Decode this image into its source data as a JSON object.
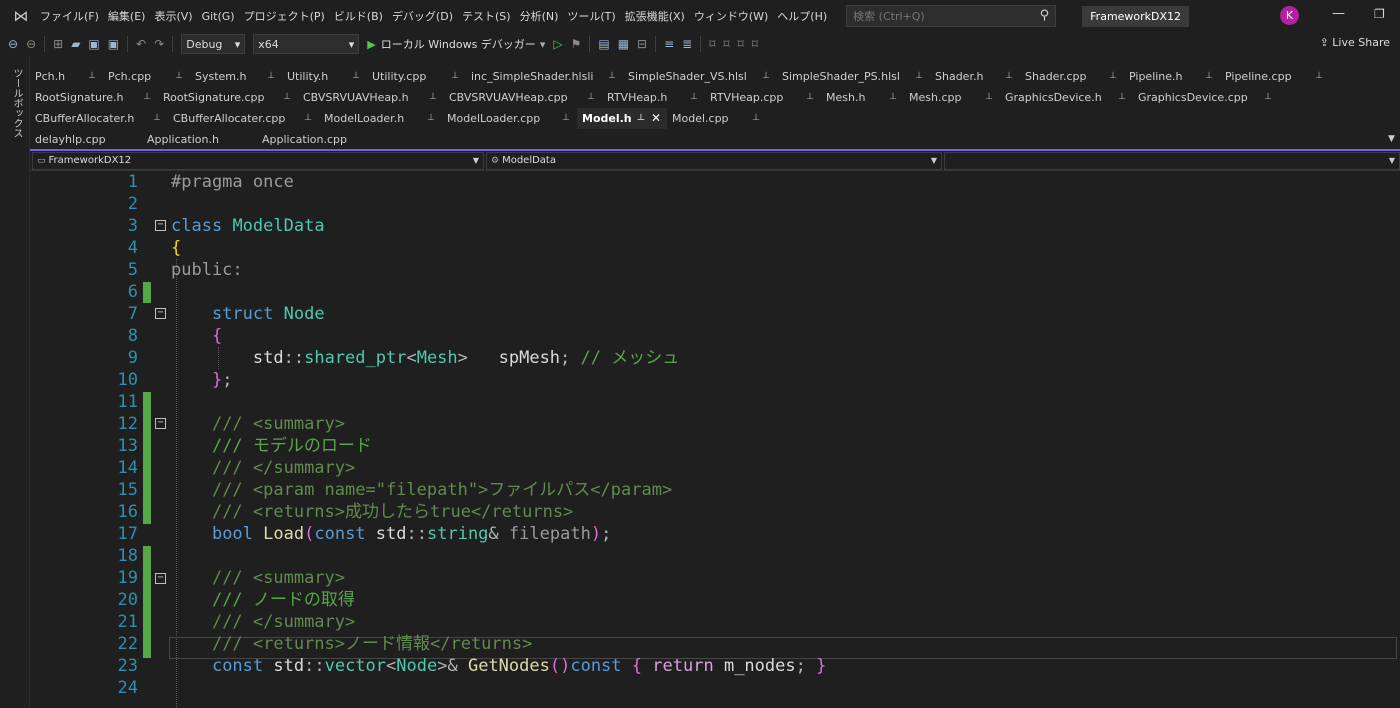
{
  "menu": {
    "items": [
      "ファイル(F)",
      "編集(E)",
      "表示(V)",
      "Git(G)",
      "プロジェクト(P)",
      "ビルド(B)",
      "デバッグ(D)",
      "テスト(S)",
      "分析(N)",
      "ツール(T)",
      "拡張機能(X)",
      "ウィンドウ(W)",
      "ヘルプ(H)"
    ],
    "search_placeholder": "検索 (Ctrl+Q)",
    "solution_name": "FrameworkDX12",
    "avatar_letter": "K"
  },
  "toolbar": {
    "configuration": "Debug",
    "platform": "x64",
    "run_label": "ローカル Windows デバッガー",
    "live_share": "Live Share"
  },
  "toolbox_label": "ツールボックス",
  "tabs": {
    "row1": [
      "Pch.h",
      "Pch.cpp",
      "System.h",
      "Utility.h",
      "Utility.cpp",
      "inc_SimpleShader.hlsli",
      "SimpleShader_VS.hlsl",
      "SimpleShader_PS.hlsl",
      "Shader.h",
      "Shader.cpp",
      "Pipeline.h",
      "Pipeline.cpp"
    ],
    "row2": [
      "RootSignature.h",
      "RootSignature.cpp",
      "CBVSRVUAVHeap.h",
      "CBVSRVUAVHeap.cpp",
      "RTVHeap.h",
      "RTVHeap.cpp",
      "Mesh.h",
      "Mesh.cpp",
      "GraphicsDevice.h",
      "GraphicsDevice.cpp"
    ],
    "row3": [
      "CBufferAllocater.h",
      "CBufferAllocater.cpp",
      "ModelLoader.h",
      "ModelLoader.cpp",
      "Model.h",
      "Model.cpp"
    ],
    "row4": [
      "delayhlp.cpp",
      "Application.h",
      "Application.cpp"
    ],
    "active": "Model.h",
    "pin_glyph": "ᵖ"
  },
  "navbar": {
    "project": "FrameworkDX12",
    "scope": "ModelData",
    "member": ""
  },
  "editor": {
    "line_numbers": [
      "1",
      "2",
      "3",
      "4",
      "5",
      "6",
      "7",
      "8",
      "9",
      "10",
      "11",
      "12",
      "13",
      "14",
      "15",
      "16",
      "17",
      "18",
      "19",
      "20",
      "21",
      "22",
      "23",
      "24"
    ],
    "tokens": {
      "pragma": "#pragma once",
      "class_kw": "class",
      "class_name": "ModelData",
      "public": "public:",
      "struct_kw": "struct",
      "struct_name": "Node",
      "std": "std",
      "shared_ptr": "shared_ptr",
      "mesh_type": "Mesh",
      "member_name": "spMesh",
      "mesh_comment": "// メッシュ",
      "doc_summary_open": "/// <summary>",
      "doc_load": "/// モデルのロード",
      "doc_summary_close": "/// </summary>",
      "doc_param": "/// <param name=\"filepath\">ファイルパス</param>",
      "doc_returns_load": "/// <returns>成功したらtrue</returns>",
      "bool_kw": "bool",
      "load_fn": "Load",
      "const_kw": "const",
      "string_type": "string",
      "filepath_param": "filepath",
      "doc_getnodes": "/// ノードの取得",
      "doc_returns_nodes": "/// <returns>ノード情報</returns>",
      "vector_type": "vector",
      "getnodes_fn": "GetNodes",
      "return_kw": "return",
      "m_nodes": "m_nodes"
    }
  },
  "colors": {
    "accent": "#7160e8",
    "line_number": "#2b91af",
    "keyword": "#569cd6",
    "type": "#4ec9b0",
    "comment": "#57a64a",
    "change_bar": "#57a64a"
  }
}
